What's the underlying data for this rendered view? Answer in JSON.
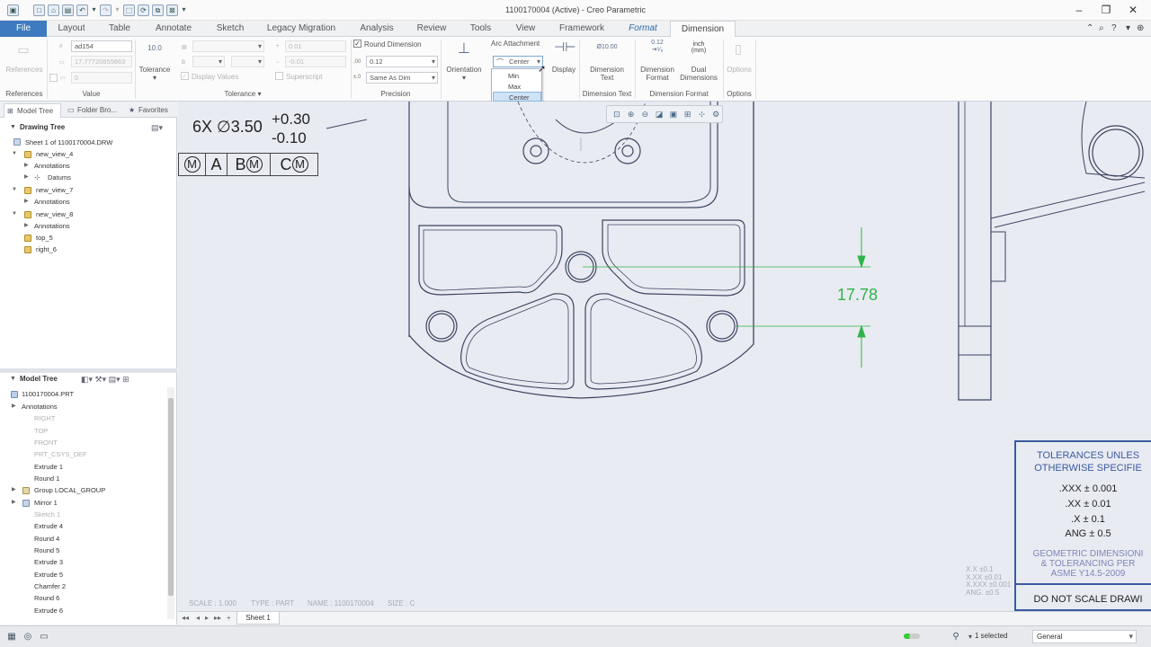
{
  "window": {
    "title": "1100170004 (Active) - Creo Parametric"
  },
  "tabs": [
    {
      "label": "File"
    },
    {
      "label": "Layout"
    },
    {
      "label": "Table"
    },
    {
      "label": "Annotate"
    },
    {
      "label": "Sketch"
    },
    {
      "label": "Legacy Migration"
    },
    {
      "label": "Analysis"
    },
    {
      "label": "Review"
    },
    {
      "label": "Tools"
    },
    {
      "label": "View"
    },
    {
      "label": "Framework"
    },
    {
      "label": "Format"
    },
    {
      "label": "Dimension"
    }
  ],
  "ribbon": {
    "groups": {
      "references": "References",
      "value": "Value",
      "tolerance": "Tolerance",
      "precision": "Precision",
      "dimension_text": "Dimension Text",
      "dimension_format": "Dimension Format",
      "options": "Options"
    },
    "references_btn": "References",
    "value": {
      "name": "ad154",
      "nominal": "17.77720855863",
      "override": "0"
    },
    "tolerance_btn": "Tolerance",
    "tolerance": {
      "upper": "0.01",
      "lower": "-0.01",
      "display_values": "Display Values",
      "superscript": "Superscript"
    },
    "precision": {
      "round_dimension": "Round Dimension",
      "round_dimension_checked": true,
      "decimal": "0.12",
      "tol_decimal": "Same As Dim"
    },
    "orientation_btn": "Orientation",
    "arc_attachment": {
      "label": "Arc Attachment",
      "selected": "Center",
      "options": [
        "Min",
        "Max",
        "Center"
      ]
    },
    "display_btn": "Display",
    "dimension_text_btn": {
      "line1": "Dimension",
      "line2": "Text"
    },
    "dimension_text_icon": "Ø10.00",
    "dimension_format_btn": {
      "line1": "Dimension",
      "line2": "Format"
    },
    "dimension_format_icon": "0.12",
    "dual_dimensions_btn": {
      "line1": "Dual",
      "line2": "Dimensions"
    },
    "dual_icon": {
      "line1": "inch",
      "line2": "(mm)"
    },
    "options_btn": "Options"
  },
  "left_panel": {
    "tabs": [
      {
        "label": "Model Tree"
      },
      {
        "label": "Folder Bro..."
      },
      {
        "label": "Favorites"
      }
    ],
    "drawing_tree": {
      "header": "Drawing Tree",
      "items": [
        {
          "label": "Sheet 1 of 1100170004.DRW",
          "dim": false
        },
        {
          "label": "new_view_4",
          "dim": false
        },
        {
          "label": "Annotations",
          "dim": false
        },
        {
          "label": "Datums",
          "dim": false
        },
        {
          "label": "new_view_7",
          "dim": false
        },
        {
          "label": "Annotations",
          "dim": false
        },
        {
          "label": "new_view_8",
          "dim": false
        },
        {
          "label": "Annotations",
          "dim": false
        },
        {
          "label": "top_5",
          "dim": false
        },
        {
          "label": "right_6",
          "dim": false
        }
      ]
    },
    "model_tree": {
      "header": "Model Tree",
      "items": [
        {
          "label": "1100170004.PRT",
          "dim": false
        },
        {
          "label": "Annotations",
          "dim": false
        },
        {
          "label": "RIGHT",
          "dim": true
        },
        {
          "label": "TOP",
          "dim": true
        },
        {
          "label": "FRONT",
          "dim": true
        },
        {
          "label": "PRT_CSYS_DEF",
          "dim": true
        },
        {
          "label": "Extrude 1",
          "dim": false
        },
        {
          "label": "Round 1",
          "dim": false
        },
        {
          "label": "Group LOCAL_GROUP",
          "dim": false
        },
        {
          "label": "Mirror 1",
          "dim": false
        },
        {
          "label": "Sketch 1",
          "dim": true
        },
        {
          "label": "Extrude 4",
          "dim": false
        },
        {
          "label": "Round 4",
          "dim": false
        },
        {
          "label": "Round 5",
          "dim": false
        },
        {
          "label": "Extrude 3",
          "dim": false
        },
        {
          "label": "Extrude 5",
          "dim": false
        },
        {
          "label": "Chamfer 2",
          "dim": false
        },
        {
          "label": "Round 6",
          "dim": false
        },
        {
          "label": "Extrude 6",
          "dim": false
        }
      ]
    }
  },
  "drawing": {
    "hole_callout": {
      "qty": "6X",
      "dia": "∅3.50",
      "tol_upper": "+0.30",
      "tol_lower": "-0.10"
    },
    "feature_control_frame": {
      "mod": "M",
      "datum_a": "A",
      "datum_b": "B",
      "datum_c": "C"
    },
    "dimension_value": "17.78",
    "dimension_color": "#2fb34a",
    "title_block": {
      "line1": "TOLERANCES UNLES",
      "line2": "OTHERWISE SPECIFIE",
      "tol_xxx": ".XXX ± 0.001",
      "tol_xx": ".XX ± 0.01",
      "tol_x": ".X ± 0.1",
      "tol_ang": "ANG ± 0.5",
      "gdt1": "GEOMETRIC DIMENSIONI",
      "gdt2": "& TOLERANCING PER",
      "gdt3": "ASME Y14.5-2009",
      "note": "DO NOT SCALE DRAWI"
    },
    "ghost_tolerances": [
      "X.X    ±0.1",
      "X.XX   ±0.01",
      "X.XXX  ±0.001",
      "ANG.   ±0.5"
    ],
    "sheet_info": {
      "scale": "SCALE : 1.000",
      "type": "TYPE : PART",
      "name": "NAME : 1100170004",
      "size": "SIZE : C"
    }
  },
  "sheets": {
    "current": "Sheet 1"
  },
  "status": {
    "selected": "1 selected",
    "filter": "General"
  }
}
